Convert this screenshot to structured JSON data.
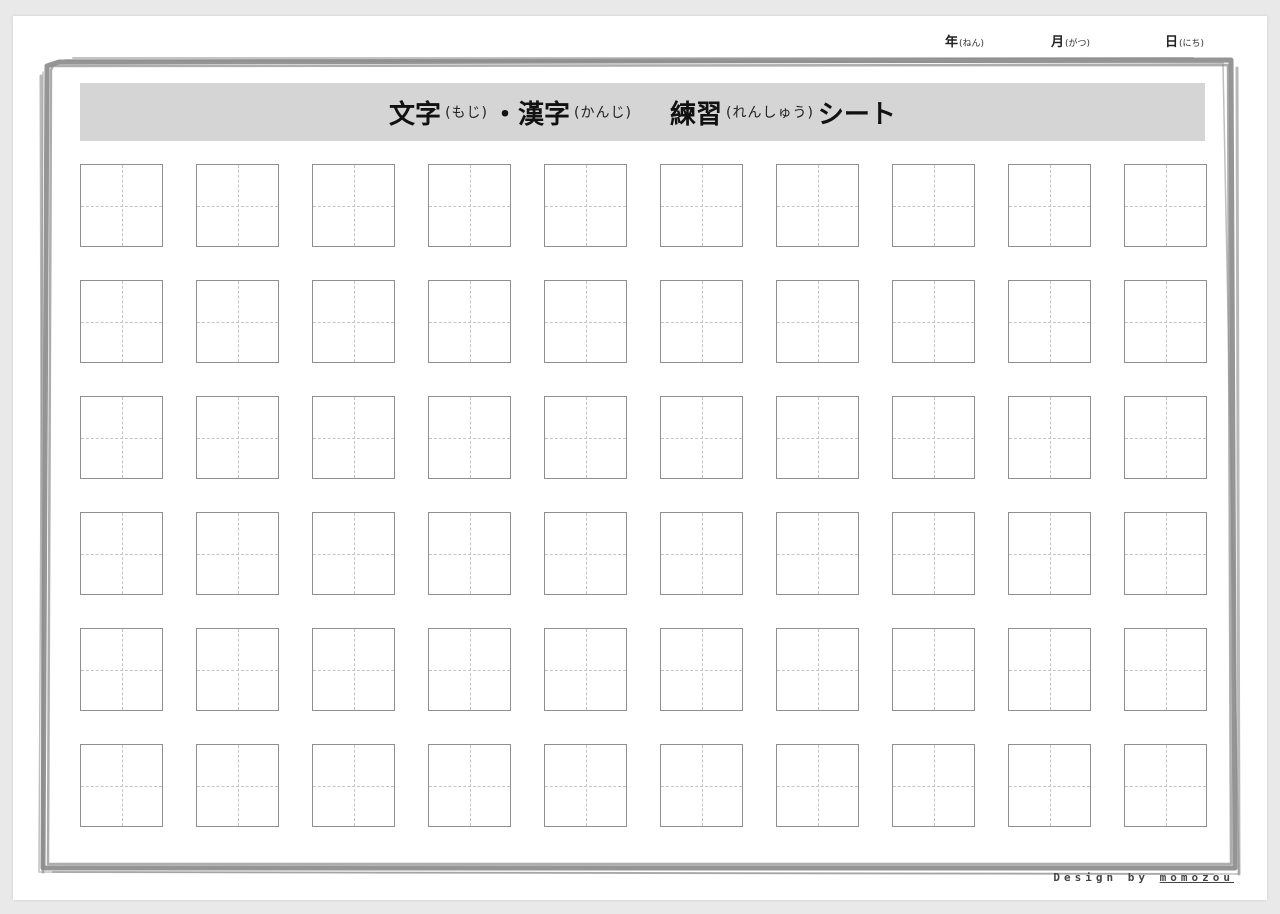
{
  "date": {
    "year_label": "年",
    "year_ruby": "(ねん)",
    "month_label": "月",
    "month_ruby": "(がつ)",
    "day_label": "日",
    "day_ruby": "(にち)"
  },
  "title": {
    "part1": "文字",
    "part1_ruby": "(もじ)",
    "separator": "・",
    "part2": "漢字",
    "part2_ruby": "(かんじ)",
    "part3": "練習",
    "part3_ruby": "(れんしゅう)",
    "part4": "シート"
  },
  "grid": {
    "rows": 6,
    "columns": 10
  },
  "credit": {
    "prefix": "Design by ",
    "brand": "momozou"
  },
  "colors": {
    "background": "#e9e9e9",
    "paper": "#ffffff",
    "title_bar": "#d6d5d6",
    "frame": "#8a8a8a",
    "cell_border": "#8f8f8f",
    "guide_line": "#c4c4c4"
  }
}
